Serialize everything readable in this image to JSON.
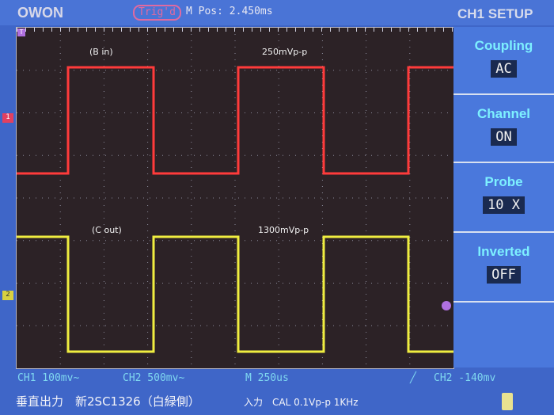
{
  "header": {
    "brand": "OWON",
    "trig_status": "Trig'd",
    "m_pos": "M Pos: 2.450ms",
    "menu_title": "CH1 SETUP"
  },
  "menu": [
    {
      "label": "Coupling",
      "value": "AC"
    },
    {
      "label": "Channel",
      "value": "ON"
    },
    {
      "label": "Probe",
      "value": "10 X"
    },
    {
      "label": "Inverted",
      "value": "OFF"
    }
  ],
  "status": {
    "ch1": "CH1 100mv~",
    "ch2": "CH2 500mv~",
    "timebase": "M 250us",
    "trigger": "CH2 -140mv"
  },
  "markers": {
    "ch1": "1",
    "ch2": "2",
    "trigger_top": "T"
  },
  "annotations": {
    "ch1_label": "(B in)",
    "ch1_amp": "250mVp-p",
    "ch2_label": "(C out)",
    "ch2_amp": "1300mVp-p"
  },
  "caption": {
    "title": "垂直出力　新2SC1326（白緑側）",
    "input": "入力　CAL 0.1Vp-p 1KHz"
  },
  "colors": {
    "ch1": "#ff3b3b",
    "ch2": "#f0ee40",
    "background": "#2c2226",
    "frame": "#3f66c8"
  }
}
